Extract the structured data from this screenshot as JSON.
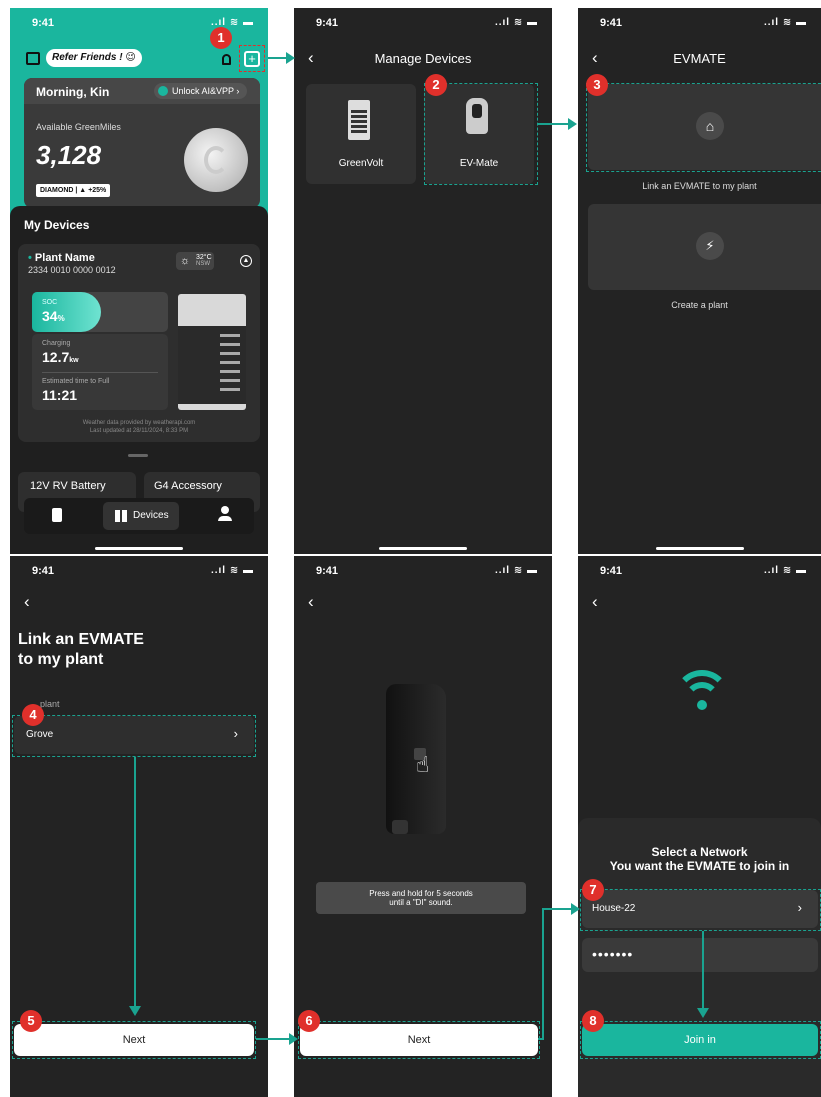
{
  "status": {
    "time": "9:41",
    "icons": "..ıl ≋ ▬"
  },
  "s1": {
    "refer": "Refer Friends !",
    "greeting": "Morning, Kin",
    "unlock": "Unlock AI&VPP",
    "avail": "Available GreenMiles",
    "miles": "3,128",
    "tier": "DIAMOND",
    "tier_pct": "+25%",
    "my_devices": "My Devices",
    "plant_name": "Plant Name",
    "plant_id": "2334 0010 0000 0012",
    "temp": "32°C",
    "temp_region": "NSW",
    "soc_label": "SOC",
    "soc_val": "34",
    "soc_unit": "%",
    "charging_label": "Charging",
    "charging_val": "12.7",
    "charging_unit": "kw",
    "eta_label": "Estimated time to Full",
    "eta_val": "11:21",
    "weather_src": "Weather data provided by weatherapi.com",
    "updated": "Last updated at 28/11/2024, 8:33 PM",
    "tile1": "12V RV Battery",
    "tile2": "G4 Accessory",
    "nav_devices": "Devices",
    "soc_fraction": 0.34
  },
  "s2": {
    "title": "Manage Devices",
    "dev1": "GreenVolt",
    "dev2": "EV-Mate"
  },
  "s3": {
    "title": "EVMATE",
    "opt1": "Link an EVMATE to my plant",
    "opt2": "Create a plant"
  },
  "s4": {
    "title1": "Link an EVMATE",
    "title2": "to my plant",
    "field_label": "plant",
    "field_val": "Grove",
    "next": "Next"
  },
  "s5": {
    "hint1": "Press and hold for 5 seconds",
    "hint2": "until a \"DI\" sound.",
    "next": "Next"
  },
  "s6": {
    "t1": "Select a Network",
    "t2": "You want the EVMATE to join in",
    "ssid": "House-22",
    "pwd": "•••••••",
    "join": "Join in"
  },
  "steps": [
    "1",
    "2",
    "3",
    "4",
    "5",
    "6",
    "7",
    "8"
  ],
  "accent": "#1ab69e",
  "marker": "#e0302b"
}
